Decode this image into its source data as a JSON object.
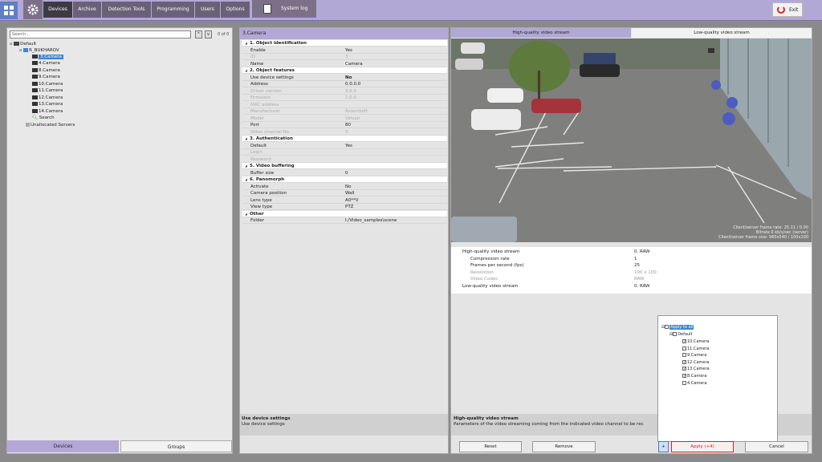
{
  "topbar": {
    "tabs": [
      "Devices",
      "Archive",
      "Detection Tools",
      "Programming",
      "Users",
      "Options"
    ],
    "syslog_label": "System log",
    "exit_label": "Exit"
  },
  "left": {
    "search_placeholder": "Search...",
    "counter": "0 of 0",
    "tree": {
      "root": "Default",
      "server": "R_BUKHAROV",
      "cameras": [
        "3.Camera",
        "4.Camera",
        "8.Camera",
        "9.Camera",
        "10.Camera",
        "11.Camera",
        "12.Camera",
        "13.Camera",
        "14.Camera"
      ],
      "search": "Search",
      "unallocated": "Unallocated Servers"
    },
    "tabs": {
      "devices": "Devices",
      "groups": "Groups"
    }
  },
  "props": {
    "title": "3.Camera",
    "rows": [
      {
        "k": "1. Object identification",
        "v": "",
        "sec": true
      },
      {
        "k": "Enable",
        "v": "Yes"
      },
      {
        "k": "ID",
        "v": "3",
        "dis": true
      },
      {
        "k": "Name",
        "v": "Camera"
      },
      {
        "k": "2. Object features",
        "v": "",
        "sec": true
      },
      {
        "k": "Use device settings",
        "v": "No",
        "bold": true
      },
      {
        "k": "Address",
        "v": "0.0.0.0"
      },
      {
        "k": "Driver version",
        "v": "3.0.0",
        "dis": true
      },
      {
        "k": "Firmware",
        "v": "1.0.0",
        "dis": true
      },
      {
        "k": "MAC address",
        "v": "",
        "dis": true
      },
      {
        "k": "Manufacturer",
        "v": "AxxonSoft",
        "dis": true
      },
      {
        "k": "Model",
        "v": "Virtual",
        "dis": true
      },
      {
        "k": "Port",
        "v": "80"
      },
      {
        "k": "Video channel No.",
        "v": "0",
        "dis": true
      },
      {
        "k": "3. Authentication",
        "v": "",
        "sec": true
      },
      {
        "k": "Default",
        "v": "Yes"
      },
      {
        "k": "Login",
        "v": "",
        "dis": true
      },
      {
        "k": "Password",
        "v": "",
        "dis": true
      },
      {
        "k": "5. Video buffering",
        "v": "",
        "sec": true
      },
      {
        "k": "Buffer size",
        "v": "0"
      },
      {
        "k": "6. Panomorph",
        "v": "",
        "sec": true
      },
      {
        "k": "Activate",
        "v": "No"
      },
      {
        "k": "Camera position",
        "v": "Wall"
      },
      {
        "k": "Lens type",
        "v": "A0**V"
      },
      {
        "k": "View type",
        "v": "PTZ"
      },
      {
        "k": "Other",
        "v": "",
        "sec": true
      },
      {
        "k": "Folder",
        "v": "I:/Video_samples\\scene"
      }
    ],
    "desc_title": "Use device settings",
    "desc_text": "Use device settings"
  },
  "stream": {
    "tab_high": "High-quality video stream",
    "tab_low": "Low-quality video stream",
    "overlay": [
      "Client/server frame rate: 25.11 / 0.00",
      "Bitrate 0 kb/s/sec (server)",
      "Client/server frame size: 960x540 / 100x100"
    ],
    "rows": [
      {
        "k": "High-quality video stream",
        "v": "0. RAW",
        "lvl": 0
      },
      {
        "k": "Compression rate",
        "v": "1",
        "lvl": 1
      },
      {
        "k": "Frames per second (fps)",
        "v": "25",
        "lvl": 1
      },
      {
        "k": "Resolution",
        "v": "100 x 100",
        "lvl": 1,
        "dis": true
      },
      {
        "k": "Video Codec",
        "v": "RAW",
        "lvl": 1,
        "dis": true
      },
      {
        "k": "Low-quality video stream",
        "v": "0. RAW",
        "lvl": 0
      }
    ],
    "desc_title": "High-quality video stream",
    "desc_text": "Parameters of the video streaming coming from the indicated video channel to be rec"
  },
  "popup": {
    "apply_all": "Apply to all",
    "group": "Default",
    "items": [
      {
        "label": "10.Camera",
        "checked": true
      },
      {
        "label": "11.Camera",
        "checked": false
      },
      {
        "label": "9.Camera",
        "checked": false
      },
      {
        "label": "12.Camera",
        "checked": true
      },
      {
        "label": "13.Camera",
        "checked": true
      },
      {
        "label": "8.Camera",
        "checked": true
      },
      {
        "label": "4.Camera",
        "checked": false
      }
    ]
  },
  "buttons": {
    "reset": "Reset",
    "remove": "Remove",
    "plus": "+",
    "apply": "Apply (+4)",
    "cancel": "Cancel"
  }
}
